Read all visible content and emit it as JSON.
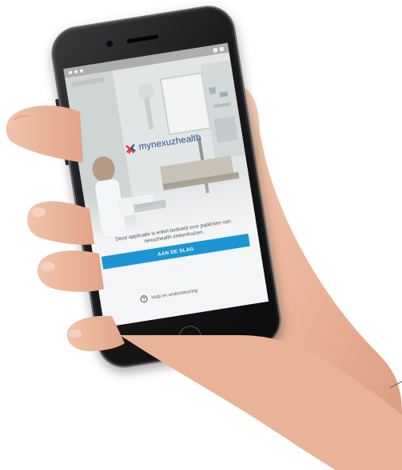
{
  "app": {
    "brand_name": "mynexuzhealth",
    "intro_text": "Deze applicatie is enkel bedoeld voor patiënten van nexuzhealth-ziekenhuizen.",
    "cta_label": "AAN DE SLAG",
    "help_label": "Hulp en ondersteuning",
    "help_icon": "question-circle-icon",
    "logo_icon": "cross-logo-icon"
  },
  "colors": {
    "accent": "#1b95d4",
    "brand_text": "#23508a",
    "logo_red": "#e0312b",
    "logo_blue": "#23508a",
    "body_text": "#555555"
  }
}
